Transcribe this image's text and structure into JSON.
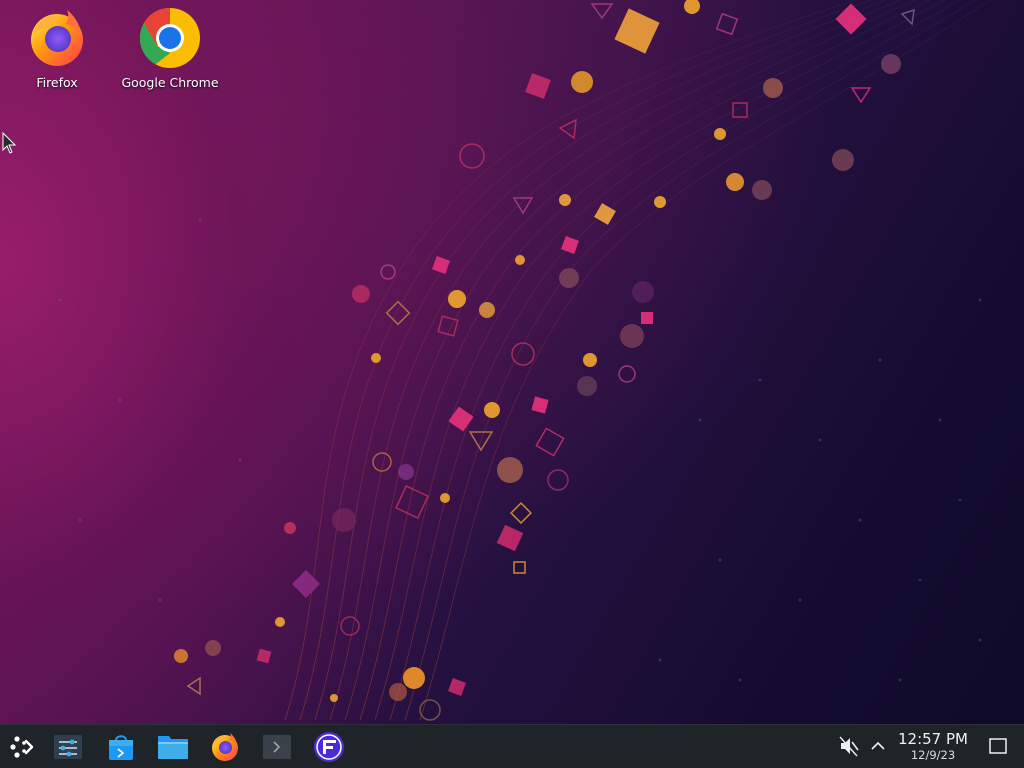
{
  "desktop": {
    "icons": [
      {
        "label": "Firefox",
        "icon": "firefox-icon"
      },
      {
        "label": "Google Chrome",
        "icon": "chrome-icon"
      }
    ]
  },
  "taskbar": {
    "launcher": {
      "icon": "application-launcher-icon"
    },
    "pinned": [
      {
        "icon": "system-settings-icon"
      },
      {
        "icon": "discover-store-icon"
      },
      {
        "icon": "file-manager-icon"
      },
      {
        "icon": "firefox-icon"
      },
      {
        "icon": "terminal-icon"
      },
      {
        "icon": "protonup-qt-icon"
      }
    ],
    "tray": {
      "volume_icon": "volume-muted-icon",
      "expand_icon": "chevron-up-icon"
    },
    "clock": {
      "time": "12:57 PM",
      "date": "12/9/23"
    },
    "show_desktop_icon": "show-desktop-icon"
  },
  "colors": {
    "taskbar_bg": "#1f2429",
    "wallpaper_pink": "#a01e6e",
    "wallpaper_navy": "#0e0a28",
    "particle_orange": "#e0902a",
    "particle_magenta": "#e0307a"
  }
}
